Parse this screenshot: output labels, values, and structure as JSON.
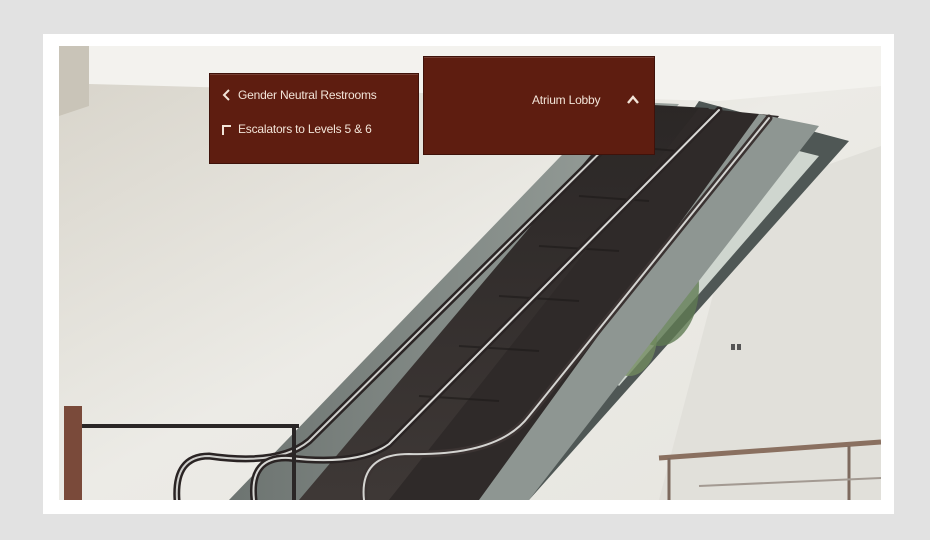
{
  "signs": {
    "restrooms_label": "Gender Neutral Restrooms",
    "escalators_label": "Escalators to Levels 5 & 6",
    "atrium_label": "Atrium Lobby"
  },
  "icons": {
    "restrooms": "chevron-left-icon",
    "escalators": "turn-up-right-icon",
    "atrium": "chevron-up-icon"
  },
  "colors": {
    "sign_bg": "#5e1d10",
    "sign_text": "#f2e4d8",
    "wall": "#eceae4",
    "backdrop": "#e2e2e2"
  }
}
